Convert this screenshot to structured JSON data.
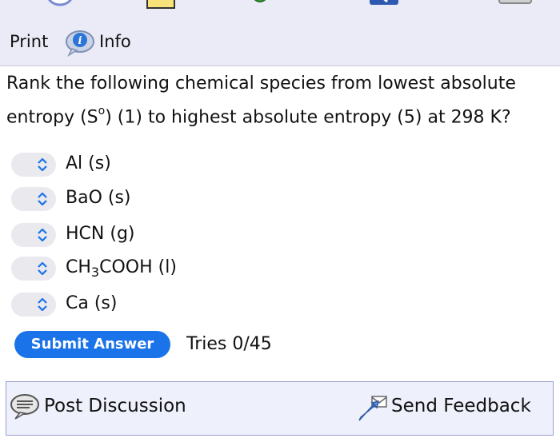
{
  "toolbar": {
    "print_label": "Print",
    "info_label": "Info"
  },
  "question": {
    "text_before": "Rank the following chemical species from lowest absolute entropy (S",
    "superscript": "o",
    "text_after": ") (1) to highest absolute entropy (5) at 298 K?"
  },
  "species": [
    {
      "label": "Al (s)"
    },
    {
      "label": "BaO (s)"
    },
    {
      "label": "HCN (g)"
    },
    {
      "label_pre": "CH",
      "subscript": "3",
      "label_post": "COOH (l)"
    },
    {
      "label": "Ca (s)"
    }
  ],
  "submit": {
    "label": "Submit Answer",
    "tries": "Tries 0/45"
  },
  "footer": {
    "post_label": "Post Discussion",
    "feedback_label": "Send Feedback"
  },
  "colors": {
    "toolbar_bg": "#ebebf7",
    "submit_bg": "#1a73e8",
    "select_bg": "#e9e9ee",
    "footer_bg": "#eef0fb"
  }
}
